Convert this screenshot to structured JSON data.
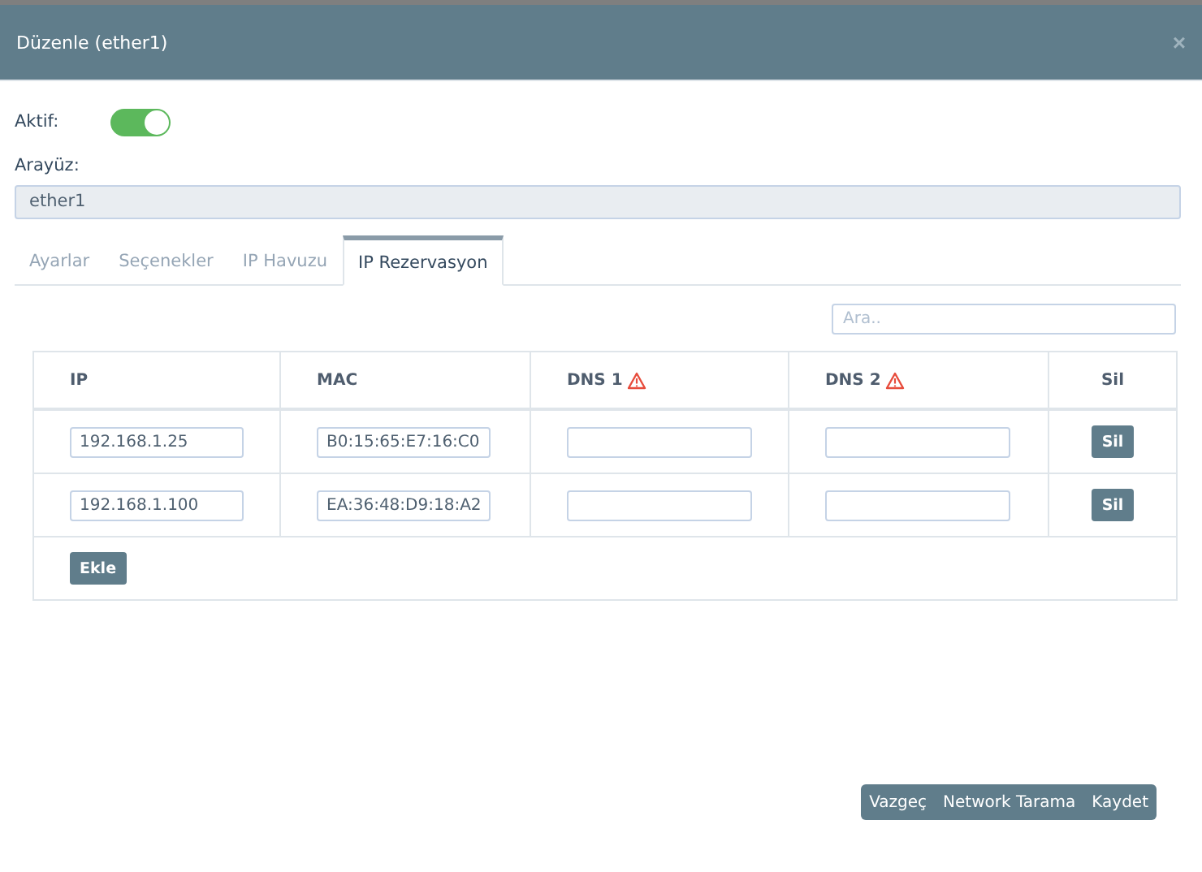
{
  "window": {
    "title": "Düzenle (ether1)",
    "close": "×"
  },
  "active": {
    "label": "Aktif:",
    "on": true
  },
  "interface": {
    "label": "Arayüz:",
    "value": "ether1"
  },
  "tabs": [
    {
      "label": "Ayarlar",
      "selected": false
    },
    {
      "label": "Seçenekler",
      "selected": false
    },
    {
      "label": "IP Havuzu",
      "selected": false
    },
    {
      "label": "IP Rezervasyon",
      "selected": true
    }
  ],
  "search": {
    "placeholder": "Ara.."
  },
  "table": {
    "columns": [
      {
        "label": "IP",
        "warning": false
      },
      {
        "label": "MAC",
        "warning": false
      },
      {
        "label": "DNS 1",
        "warning": true
      },
      {
        "label": "DNS 2",
        "warning": true
      },
      {
        "label": "Sil",
        "warning": false
      }
    ],
    "rows": [
      {
        "ip": "192.168.1.25",
        "mac": "B0:15:65:E7:16:C0",
        "delete": "Sil"
      },
      {
        "ip": "192.168.1.100",
        "mac": "EA:36:48:D9:18:A2",
        "delete": "Sil"
      }
    ],
    "add_button": "Ekle"
  },
  "buttons": [
    "Vazgeç",
    "Network Tarama",
    "Kaydet"
  ]
}
